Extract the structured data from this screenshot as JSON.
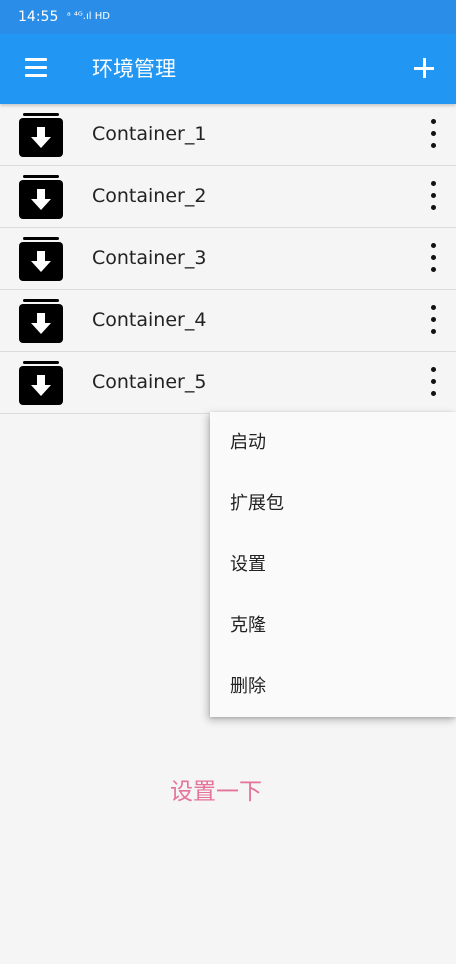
{
  "status_bar": {
    "time": "14:55",
    "indicators": "ᵃ ⁴ᴳ.ıl HD"
  },
  "app_bar": {
    "title": "环境管理"
  },
  "containers": [
    {
      "name": "Container_1"
    },
    {
      "name": "Container_2"
    },
    {
      "name": "Container_3"
    },
    {
      "name": "Container_4"
    },
    {
      "name": "Container_5"
    }
  ],
  "popup_menu": {
    "items": [
      {
        "label": "启动"
      },
      {
        "label": "扩展包"
      },
      {
        "label": "设置"
      },
      {
        "label": "克隆"
      },
      {
        "label": "删除"
      }
    ]
  },
  "hint_text": "设置一下",
  "colors": {
    "app_bar": "#2196f3",
    "status_bar": "#2a8ee8",
    "hint": "#e57399",
    "background": "#f5f5f5"
  }
}
